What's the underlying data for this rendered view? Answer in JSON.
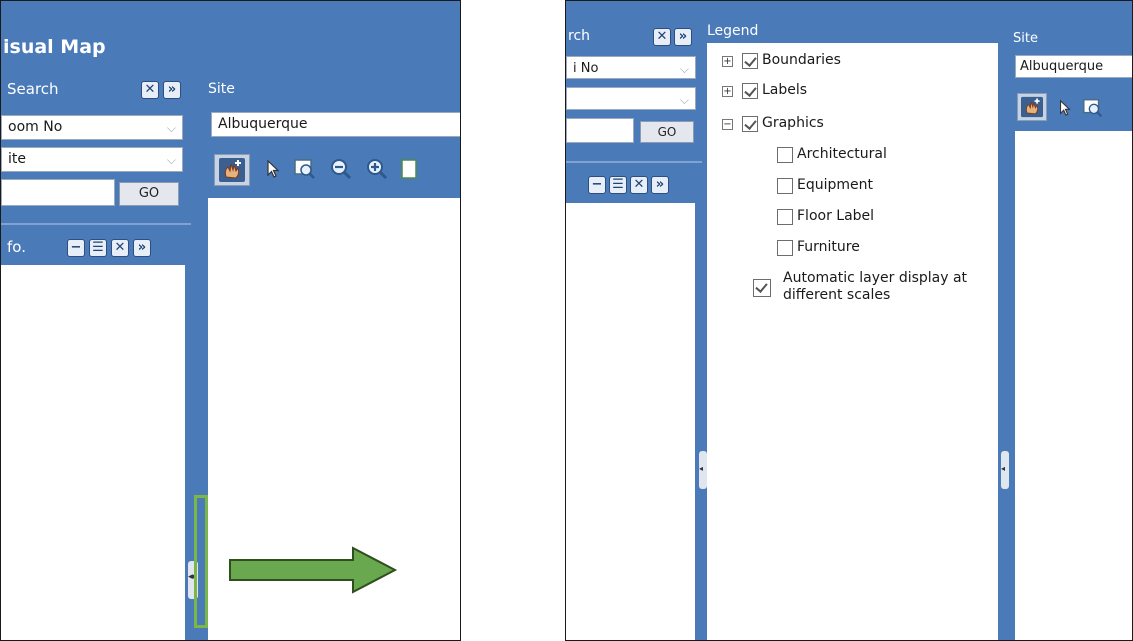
{
  "left_panel": {
    "app_title": "isual Map",
    "search_label": "Search",
    "search_dropdown_1": "oom No",
    "search_dropdown_2": "ite",
    "go_label": "GO",
    "info_label": "fo.",
    "site_label": "Site",
    "site_value": "Albuquerque"
  },
  "right_panel": {
    "search_label": "rch",
    "search_dropdown_1": "i No",
    "go_label": "GO",
    "legend_title": "Legend",
    "site_label": "Site",
    "site_value": "Albuquerque",
    "legend_items": [
      {
        "label": "Boundaries",
        "checked": true,
        "expander": "+"
      },
      {
        "label": "Labels",
        "checked": true,
        "expander": "+"
      },
      {
        "label": "Graphics",
        "checked": true,
        "expander": "−"
      },
      {
        "label": "Architectural",
        "checked": false
      },
      {
        "label": "Equipment",
        "checked": false
      },
      {
        "label": "Floor Label",
        "checked": false
      },
      {
        "label": "Furniture",
        "checked": false
      }
    ],
    "auto_layer_line1": "Automatic layer display at",
    "auto_layer_line2": "different scales",
    "auto_layer_checked": true
  },
  "icons": {
    "close": "✕",
    "expand": "»",
    "minimize": "−",
    "list": "☰",
    "grip": "◂▸"
  },
  "colors": {
    "header_blue": "#4a7ab8",
    "highlight_green": "#7ab648",
    "arrow_green": "#6aa84f"
  }
}
